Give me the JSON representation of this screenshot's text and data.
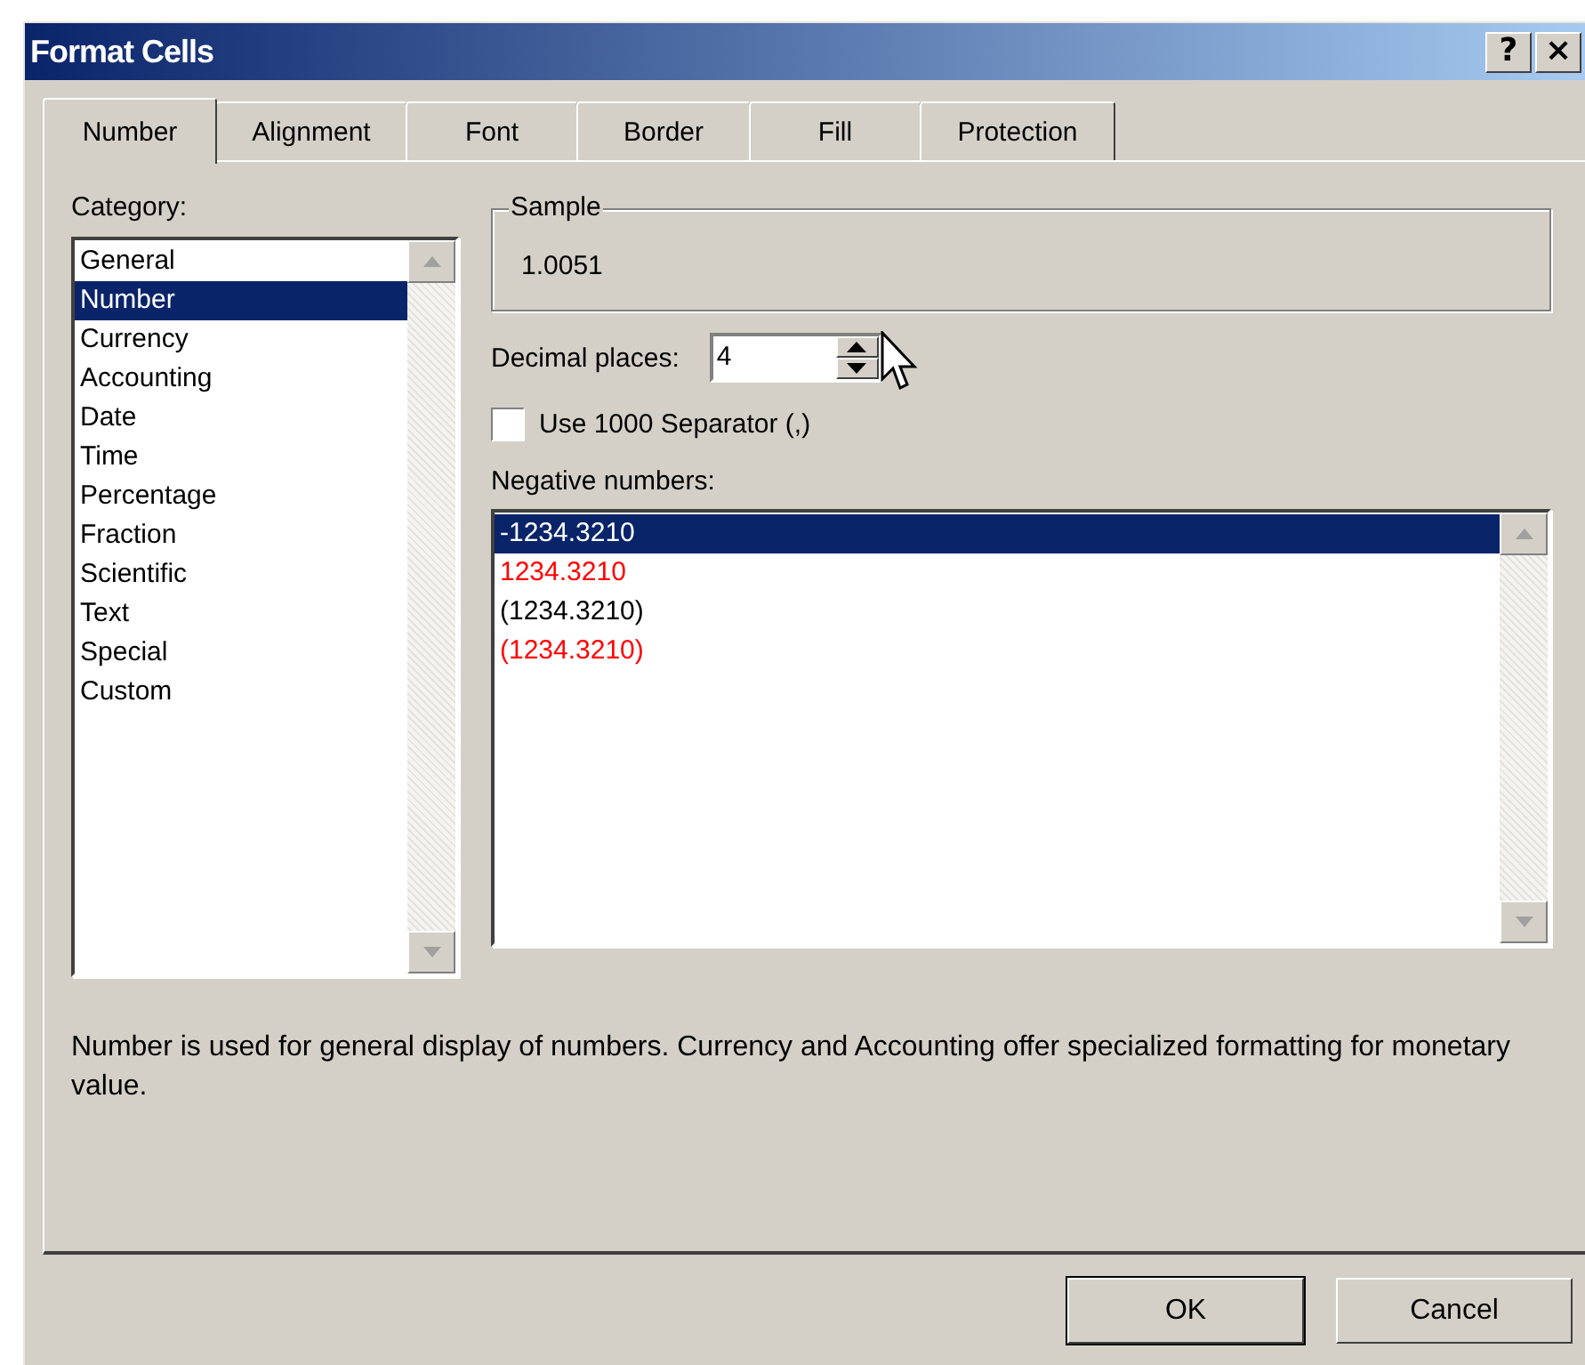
{
  "window": {
    "title": "Format Cells",
    "title_buttons": [
      "?",
      "×"
    ]
  },
  "tabs": [
    {
      "label": "Number",
      "selected": true
    },
    {
      "label": "Alignment",
      "selected": false
    },
    {
      "label": "Font",
      "selected": false
    },
    {
      "label": "Border",
      "selected": false
    },
    {
      "label": "Fill",
      "selected": false
    },
    {
      "label": "Protection",
      "selected": false
    }
  ],
  "category": {
    "label": "Category:",
    "items": [
      {
        "label": "General",
        "selected": false
      },
      {
        "label": "Number",
        "selected": true
      },
      {
        "label": "Currency",
        "selected": false
      },
      {
        "label": "Accounting",
        "selected": false
      },
      {
        "label": "Date",
        "selected": false
      },
      {
        "label": "Time",
        "selected": false
      },
      {
        "label": "Percentage",
        "selected": false
      },
      {
        "label": "Fraction",
        "selected": false
      },
      {
        "label": "Scientific",
        "selected": false
      },
      {
        "label": "Text",
        "selected": false
      },
      {
        "label": "Special",
        "selected": false
      },
      {
        "label": "Custom",
        "selected": false
      }
    ]
  },
  "sample": {
    "label": "Sample",
    "value": "1.0051"
  },
  "decimal_places": {
    "label": "Decimal places:",
    "value": "4"
  },
  "separator": {
    "label": "Use 1000 Separator (,)",
    "checked": false
  },
  "negative_numbers": {
    "label": "Negative numbers:",
    "items": [
      {
        "label": "-1234.3210",
        "selected": true
      },
      {
        "label": "1234.3210",
        "selected": false,
        "color": "#ff0000"
      },
      {
        "label": "(1234.3210)",
        "selected": false,
        "color": "#000000"
      },
      {
        "label": "(1234.3210)",
        "selected": false,
        "color": "#ff0000"
      }
    ]
  },
  "description": "Number is used for general display of numbers.  Currency and Accounting offer specialized formatting for monetary value.",
  "buttons": [
    "OK",
    "Cancel"
  ]
}
